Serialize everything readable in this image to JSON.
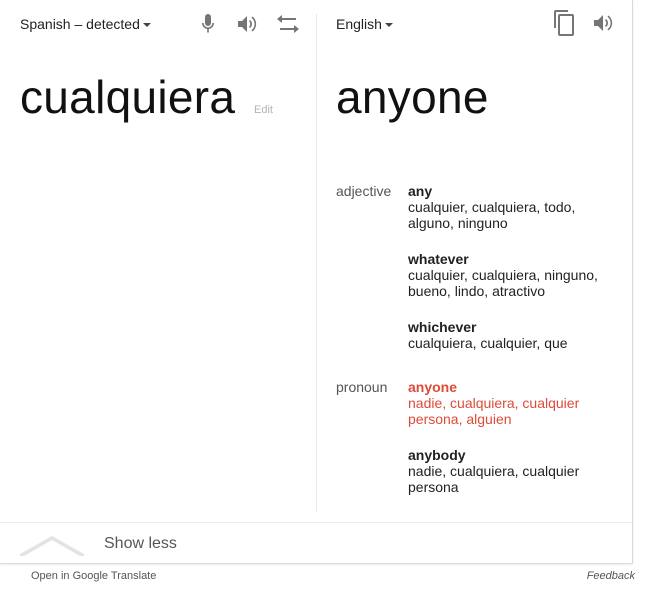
{
  "source": {
    "language": "Spanish – detected",
    "text": "cualquiera",
    "edit_label": "Edit"
  },
  "target": {
    "language": "English",
    "text": "anyone"
  },
  "icons": {
    "mic": "microphone-icon",
    "speaker": "speaker-icon",
    "swap": "swap-icon",
    "copy": "copy-icon"
  },
  "dictionary": {
    "adjective": {
      "label": "adjective",
      "entries": [
        {
          "word": "any",
          "synonyms": "cualquier, cualquiera, todo, alguno, ninguno"
        },
        {
          "word": "whatever",
          "synonyms": "cualquier, cualquiera, ninguno, bueno, lindo, atractivo"
        },
        {
          "word": "whichever",
          "synonyms": "cualquiera, cualquier, que"
        }
      ]
    },
    "pronoun": {
      "label": "pronoun",
      "entries": [
        {
          "word": "anyone",
          "synonyms": "nadie, cualquiera, cualquier persona, alguien"
        },
        {
          "word": "anybody",
          "synonyms": "nadie, cualquiera, cualquier persona"
        }
      ]
    }
  },
  "footer": {
    "show_less": "Show less",
    "open_link": "Open in Google Translate",
    "feedback": "Feedback"
  },
  "colors": {
    "highlight": "#dd4b39",
    "icon": "#757575"
  }
}
